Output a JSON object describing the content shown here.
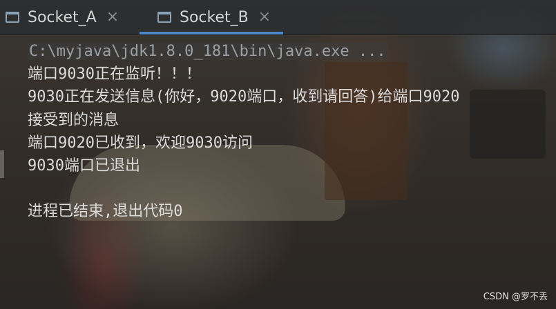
{
  "tabs": [
    {
      "label": "Socket_A",
      "close": "×",
      "active": false
    },
    {
      "label": "Socket_B",
      "close": "×",
      "active": true
    }
  ],
  "console": {
    "command": "C:\\myjava\\jdk1.8.0_181\\bin\\java.exe ...",
    "lines": [
      "端口9030正在监听！！！",
      "9030正在发送信息(你好，9020端口，收到请回答)给端口9020",
      "接受到的消息",
      "端口9020已收到，欢迎9030访问",
      "9030端口已退出",
      "",
      "进程已结束,退出代码0"
    ]
  },
  "watermark": "CSDN @罗不丢",
  "colors": {
    "accent": "#4a88c7",
    "text": "#dcdcdc",
    "command_text": "#9aa0a6"
  },
  "icons": {
    "tab_icon": "console-window-icon",
    "close_icon": "close-icon"
  }
}
